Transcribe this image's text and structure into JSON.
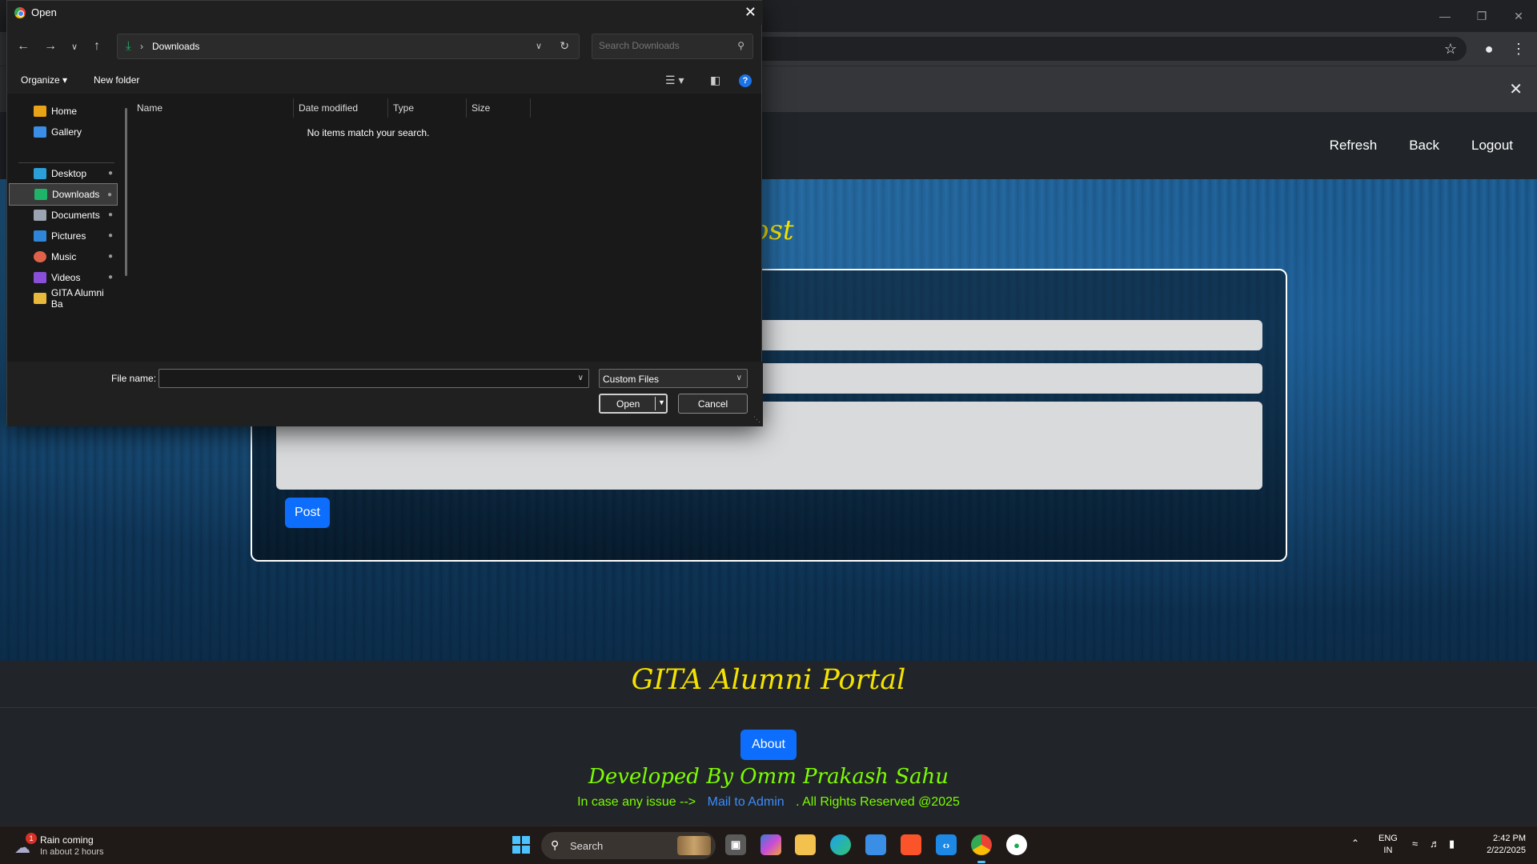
{
  "dialog": {
    "title": "Open",
    "location": "Downloads",
    "search_placeholder": "Search Downloads",
    "commands": {
      "organize": "Organize ▾",
      "new_folder": "New folder"
    },
    "nav_items": [
      {
        "label": "Home",
        "icon": "home-icon",
        "pinned": false
      },
      {
        "label": "Gallery",
        "icon": "gallery-icon",
        "pinned": false
      },
      {
        "label": "Desktop",
        "icon": "desktop-icon",
        "pinned": true
      },
      {
        "label": "Downloads",
        "icon": "downloads-icon",
        "pinned": true,
        "selected": true
      },
      {
        "label": "Documents",
        "icon": "documents-icon",
        "pinned": true
      },
      {
        "label": "Pictures",
        "icon": "pictures-icon",
        "pinned": true
      },
      {
        "label": "Music",
        "icon": "music-icon",
        "pinned": true
      },
      {
        "label": "Videos",
        "icon": "videos-icon",
        "pinned": true
      },
      {
        "label": "GITA Alumni Ba",
        "icon": "folder-icon",
        "pinned": false
      }
    ],
    "columns": [
      "Name",
      "Date modified",
      "Type",
      "Size"
    ],
    "empty_message": "No items match your search.",
    "file_name_label": "File name:",
    "file_name_value": "",
    "file_type": "Custom Files",
    "open_label": "Open",
    "cancel_label": "Cancel"
  },
  "page": {
    "nav": {
      "refresh": "Refresh",
      "back": "Back",
      "logout": "Logout"
    },
    "heading_fragment": "ost",
    "post_label": "Post"
  },
  "footer": {
    "brand": "GITA Alumni Portal",
    "about_label": "About",
    "developed_by": "Developed By Omm Prakash Sahu",
    "issue_text": "In case any issue -->",
    "mail_link": "Mail to Admin",
    "rights": ". All Rights Reserved @2025"
  },
  "taskbar": {
    "weather_title": "Rain coming",
    "weather_sub": "In about 2 hours",
    "weather_badge": "1",
    "search_label": "Search",
    "lang_line1": "ENG",
    "lang_line2": "IN",
    "time": "2:42 PM",
    "date": "2/22/2025"
  },
  "colors": {
    "accent_blue": "#0d6efd",
    "brand_yellow": "#f5e200",
    "footer_green": "#7cfc00",
    "link_blue": "#3d8bfd"
  }
}
